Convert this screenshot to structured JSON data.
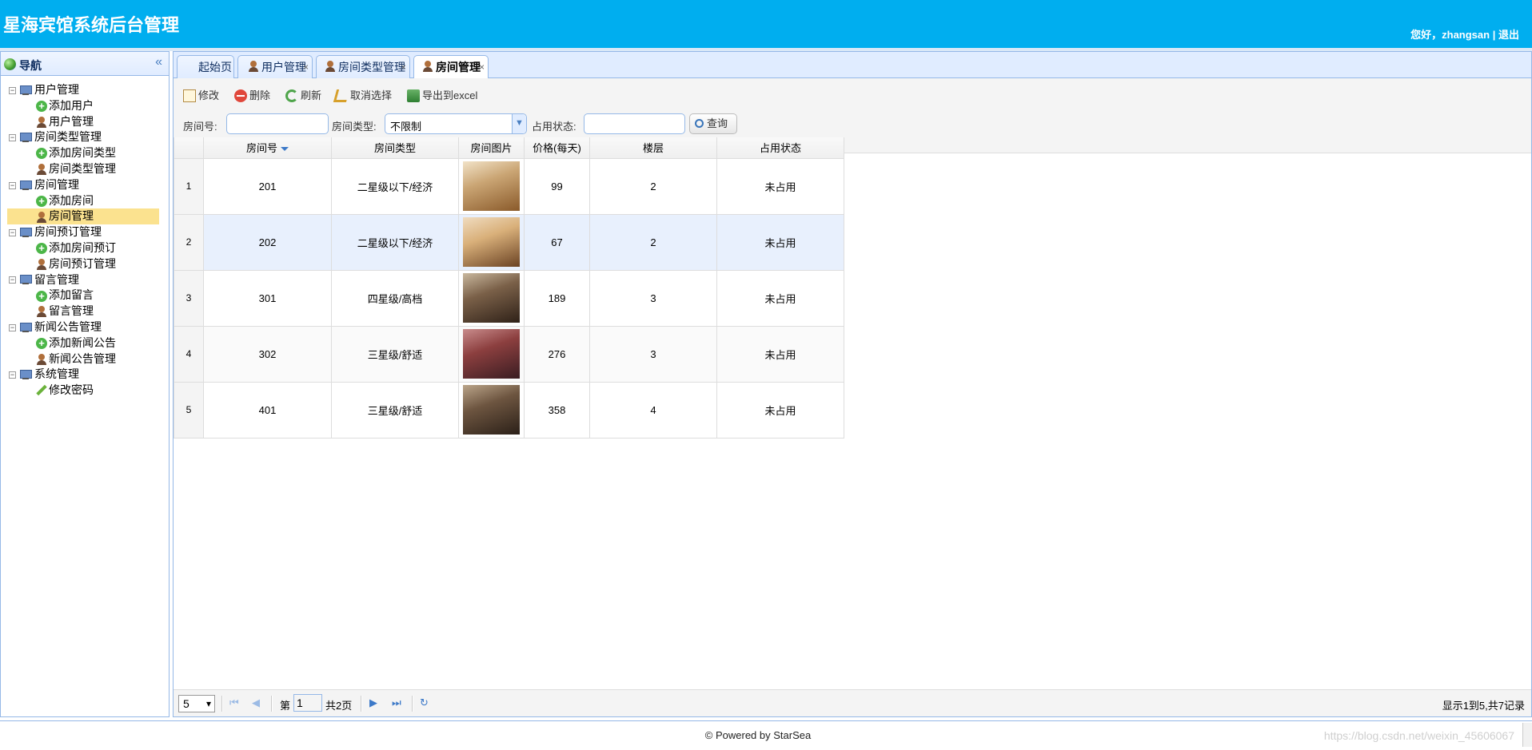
{
  "app": {
    "title": "星海宾馆系统后台管理",
    "greeting": "您好，zhangsan",
    "divider": "|",
    "logout": "退出"
  },
  "nav": {
    "title": "导航",
    "collapse": "«",
    "groups": [
      {
        "label": "用户管理",
        "items": [
          {
            "label": "添加用户",
            "icon": "add"
          },
          {
            "label": "用户管理",
            "icon": "user"
          }
        ]
      },
      {
        "label": "房间类型管理",
        "items": [
          {
            "label": "添加房间类型",
            "icon": "add"
          },
          {
            "label": "房间类型管理",
            "icon": "user"
          }
        ]
      },
      {
        "label": "房间管理",
        "items": [
          {
            "label": "添加房间",
            "icon": "add"
          },
          {
            "label": "房间管理",
            "icon": "user",
            "selected": true
          }
        ]
      },
      {
        "label": "房间预订管理",
        "items": [
          {
            "label": "添加房间预订",
            "icon": "add"
          },
          {
            "label": "房间预订管理",
            "icon": "user"
          }
        ]
      },
      {
        "label": "留言管理",
        "items": [
          {
            "label": "添加留言",
            "icon": "add"
          },
          {
            "label": "留言管理",
            "icon": "user"
          }
        ]
      },
      {
        "label": "新闻公告管理",
        "items": [
          {
            "label": "添加新闻公告",
            "icon": "add"
          },
          {
            "label": "新闻公告管理",
            "icon": "user"
          }
        ]
      },
      {
        "label": "系统管理",
        "items": [
          {
            "label": "修改密码",
            "icon": "pencil"
          }
        ]
      }
    ]
  },
  "tabs": [
    {
      "label": "起始页",
      "closable": false
    },
    {
      "label": "用户管理",
      "closable": true
    },
    {
      "label": "房间类型管理",
      "closable": true
    },
    {
      "label": "房间管理",
      "closable": true,
      "active": true
    }
  ],
  "toolbar": {
    "edit": "修改",
    "delete": "删除",
    "refresh": "刷新",
    "cancel_select": "取消选择",
    "export": "导出到excel"
  },
  "filters": {
    "room_no_label": "房间号:",
    "room_no_value": "",
    "room_type_label": "房间类型:",
    "room_type_value": "不限制",
    "occupied_label": "占用状态:",
    "occupied_value": "",
    "query": "查询"
  },
  "grid": {
    "columns": [
      "房间号",
      "房间类型",
      "房间图片",
      "价格(每天)",
      "楼层",
      "占用状态"
    ],
    "rows": [
      {
        "rn": "1",
        "room_no": "201",
        "type": "二星级以下/经济",
        "price": "99",
        "floor": "2",
        "status": "未占用"
      },
      {
        "rn": "2",
        "room_no": "202",
        "type": "二星级以下/经济",
        "price": "67",
        "floor": "2",
        "status": "未占用"
      },
      {
        "rn": "3",
        "room_no": "301",
        "type": "四星级/高档",
        "price": "189",
        "floor": "3",
        "status": "未占用"
      },
      {
        "rn": "4",
        "room_no": "302",
        "type": "三星级/舒适",
        "price": "276",
        "floor": "3",
        "status": "未占用"
      },
      {
        "rn": "5",
        "room_no": "401",
        "type": "三星级/舒适",
        "price": "358",
        "floor": "4",
        "status": "未占用"
      }
    ]
  },
  "pager": {
    "page_size": "5",
    "page_prefix": "第",
    "page_value": "1",
    "page_total": "共2页",
    "info": "显示1到5,共7记录"
  },
  "footer": {
    "text": "© Powered by StarSea",
    "watermark": "https://blog.csdn.net/weixin_45606067"
  },
  "colors": {
    "header": "#00aeef",
    "border": "#95b8e7",
    "selected": "#fbe28f"
  }
}
